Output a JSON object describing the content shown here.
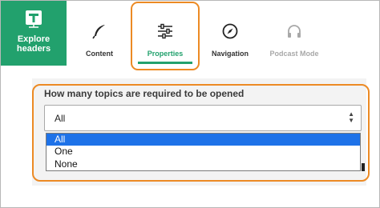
{
  "brand": {
    "label_line1": "Explore",
    "label_line2": "headers",
    "color": "#22a16d"
  },
  "tabs": [
    {
      "label": "Content",
      "icon": "feather-icon"
    },
    {
      "label": "Properties",
      "icon": "sliders-icon",
      "active": true
    },
    {
      "label": "Navigation",
      "icon": "compass-icon"
    },
    {
      "label": "Podcast Mode",
      "icon": "headphones-icon",
      "disabled": true
    }
  ],
  "form": {
    "question": "How many topics are required to be opened",
    "selected": "All",
    "options": [
      "All",
      "One",
      "None"
    ]
  },
  "colors": {
    "accent": "#22a16d",
    "highlight": "#ec8a24",
    "selection": "#1e72e8"
  }
}
